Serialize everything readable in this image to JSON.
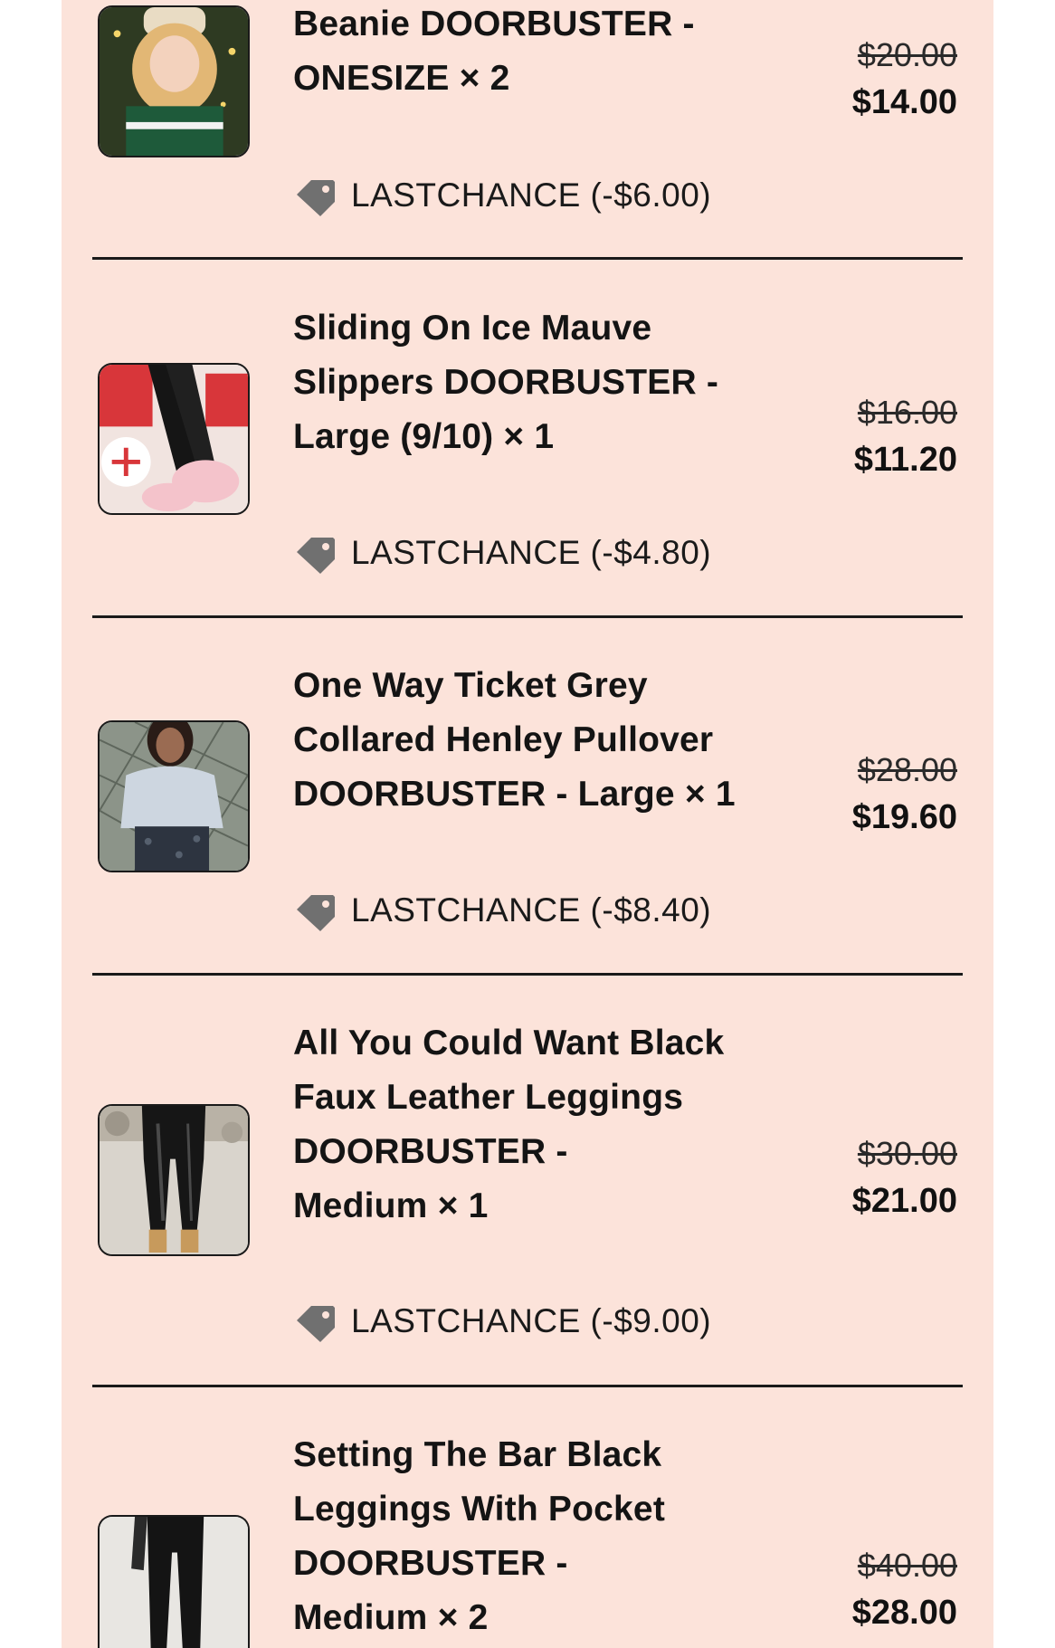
{
  "items": [
    {
      "title": "Beanie DOORBUSTER -\nONESIZE × 2",
      "original_price": "$20.00",
      "sale_price": "$14.00",
      "discount": "LASTCHANCE (-$6.00)",
      "thumbnail_icon": "beanie-product-photo"
    },
    {
      "title": "Sliding On Ice Mauve\nSlippers DOORBUSTER -\nLarge (9/10) × 1",
      "original_price": "$16.00",
      "sale_price": "$11.20",
      "discount": "LASTCHANCE (-$4.80)",
      "thumbnail_icon": "slippers-product-photo"
    },
    {
      "title": "One Way Ticket Grey\nCollared Henley Pullover\nDOORBUSTER - Large × 1",
      "original_price": "$28.00",
      "sale_price": "$19.60",
      "discount": "LASTCHANCE (-$8.40)",
      "thumbnail_icon": "pullover-product-photo"
    },
    {
      "title": "All You Could Want Black\nFaux Leather Leggings\nDOORBUSTER -\nMedium × 1",
      "original_price": "$30.00",
      "sale_price": "$21.00",
      "discount": "LASTCHANCE (-$9.00)",
      "thumbnail_icon": "leather-leggings-product-photo"
    },
    {
      "title": "Setting The Bar Black\nLeggings With Pocket\nDOORBUSTER -\nMedium × 2",
      "original_price": "$40.00",
      "sale_price": "$28.00",
      "thumbnail_icon": "pocket-leggings-product-photo"
    }
  ],
  "colors": {
    "panel_background": "#fce3da",
    "divider": "#1a1a1a",
    "tag_icon": "#707070"
  }
}
